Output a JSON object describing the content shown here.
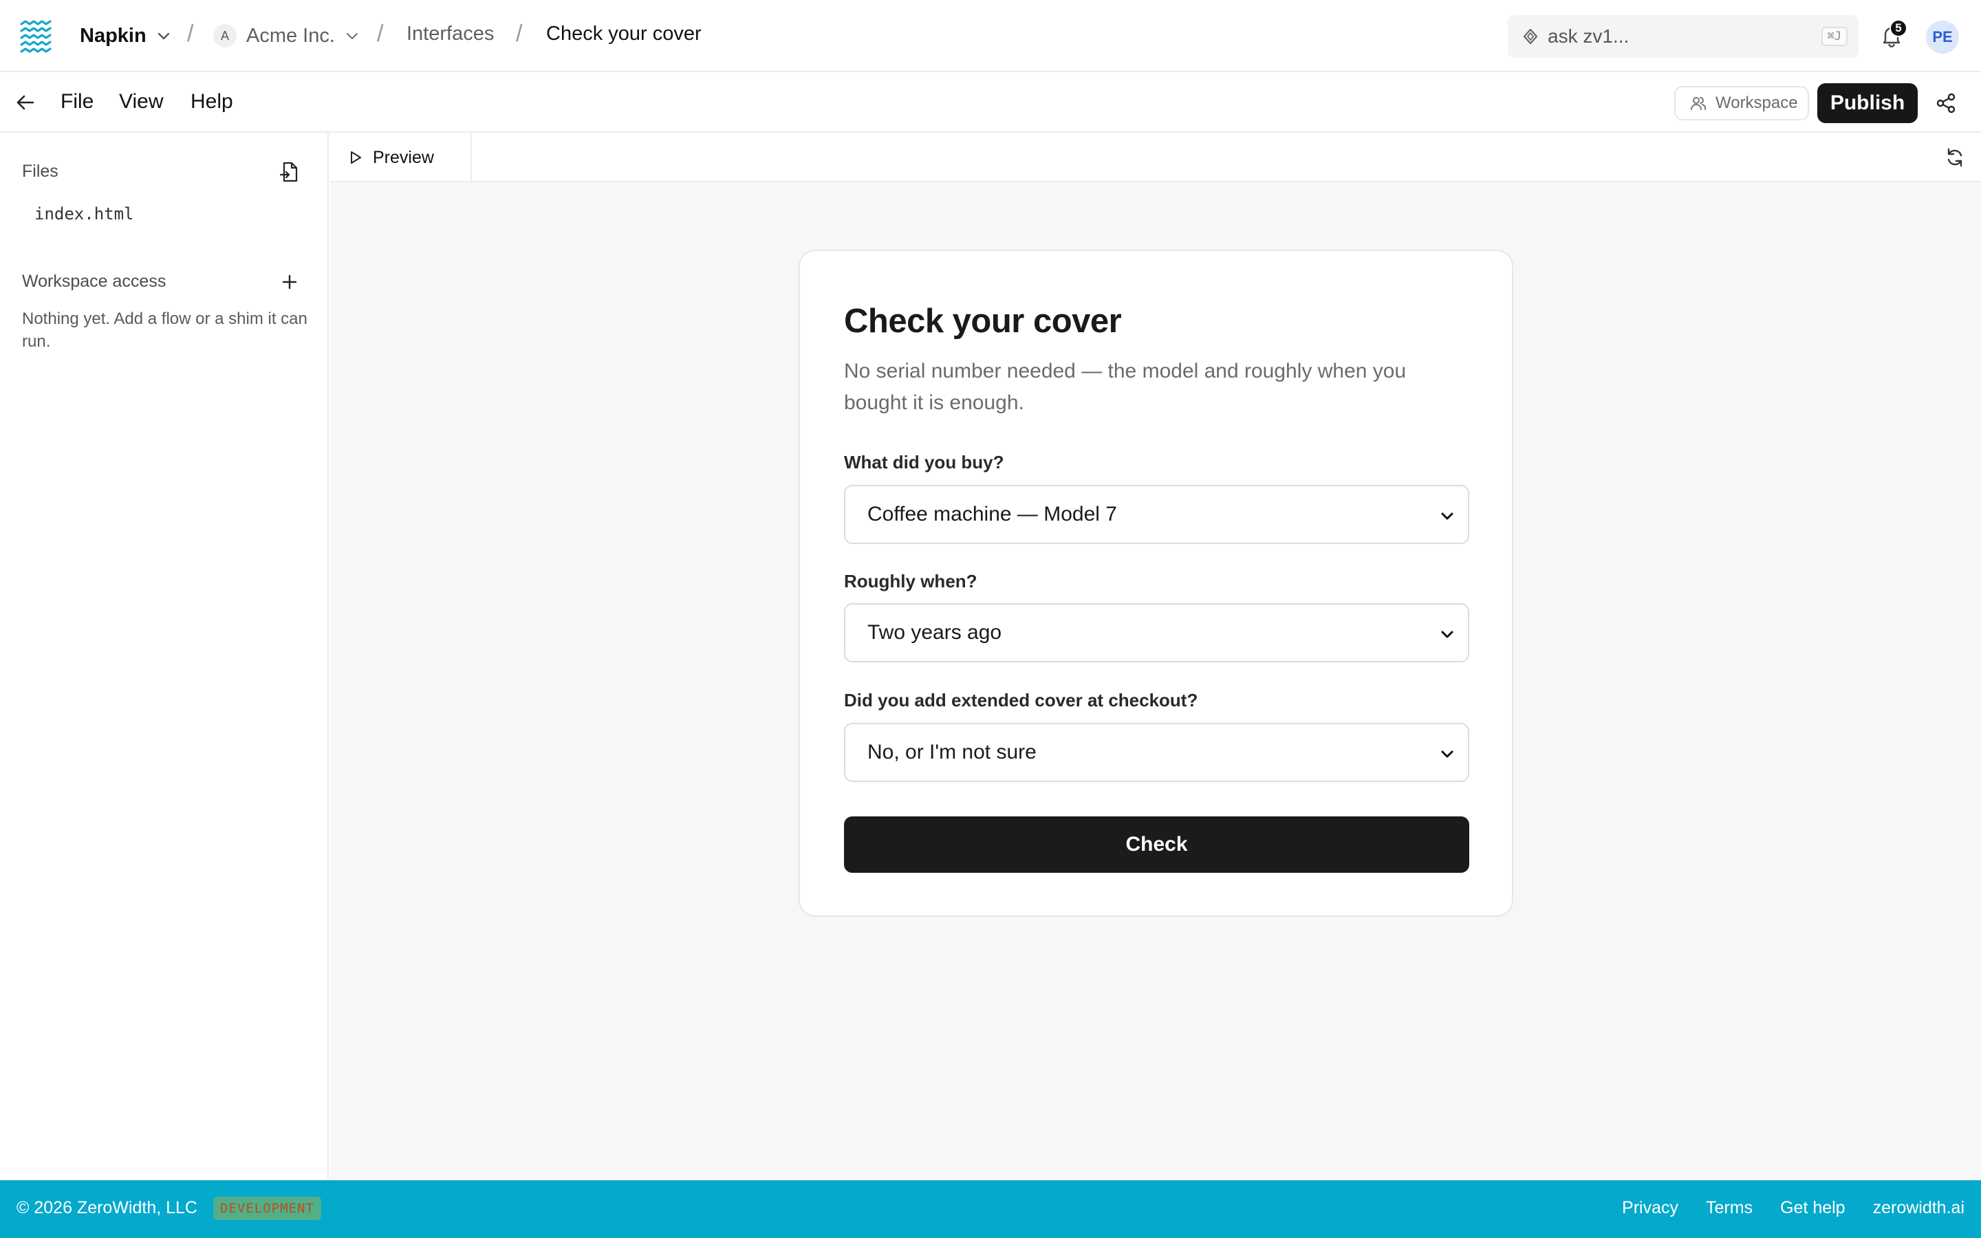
{
  "header": {
    "app_name": "Napkin",
    "breadcrumb_separator": "/",
    "org_initial": "A",
    "org_name": "Acme Inc.",
    "section": "Interfaces",
    "page": "Check your cover",
    "search_placeholder": "ask zv1...",
    "search_shortcut": "⌘J",
    "notification_count": "5",
    "user_initials": "PE"
  },
  "menubar": {
    "items": [
      "File",
      "View",
      "Help"
    ],
    "workspace_label": "Workspace",
    "publish_label": "Publish"
  },
  "sidebar": {
    "files_heading": "Files",
    "files": [
      "index.html"
    ],
    "workspace_access_heading": "Workspace access",
    "workspace_access_empty": "Nothing yet. Add a flow or a shim it can run."
  },
  "preview": {
    "tab_label": "Preview"
  },
  "form": {
    "title": "Check your cover",
    "subtitle": "No serial number needed — the model and roughly when you bought it is enough.",
    "fields": [
      {
        "label": "What did you buy?",
        "value": "Coffee machine — Model 7"
      },
      {
        "label": "Roughly when?",
        "value": "Two years ago"
      },
      {
        "label": "Did you add extended cover at checkout?",
        "value": "No, or I'm not sure"
      }
    ],
    "submit_label": "Check"
  },
  "footer": {
    "copyright": "© 2026 ZeroWidth, LLC",
    "env_badge": "DEVELOPMENT",
    "links": [
      "Privacy",
      "Terms",
      "Get help",
      "zerowidth.ai"
    ]
  },
  "colors": {
    "brand_footer": "#05a9cc",
    "logo": "#1aa7c8",
    "publish_button": "#171717",
    "submit_button": "#1c1b19",
    "env_badge_bg": "#4fb08a",
    "avatar_bg": "#dbe7fb"
  },
  "icons": {
    "logo": "napkin-logo-icon",
    "app_dropdown": "chevron-down-icon",
    "search": "sparkle-search-icon",
    "notifications": "bell-icon",
    "back": "arrow-left-icon",
    "workspace": "users-icon",
    "share": "share-icon",
    "new_file": "new-file-icon",
    "add_access": "plus-icon",
    "preview": "play-icon",
    "refresh": "refresh-icon",
    "select_caret": "chevron-down-icon"
  }
}
